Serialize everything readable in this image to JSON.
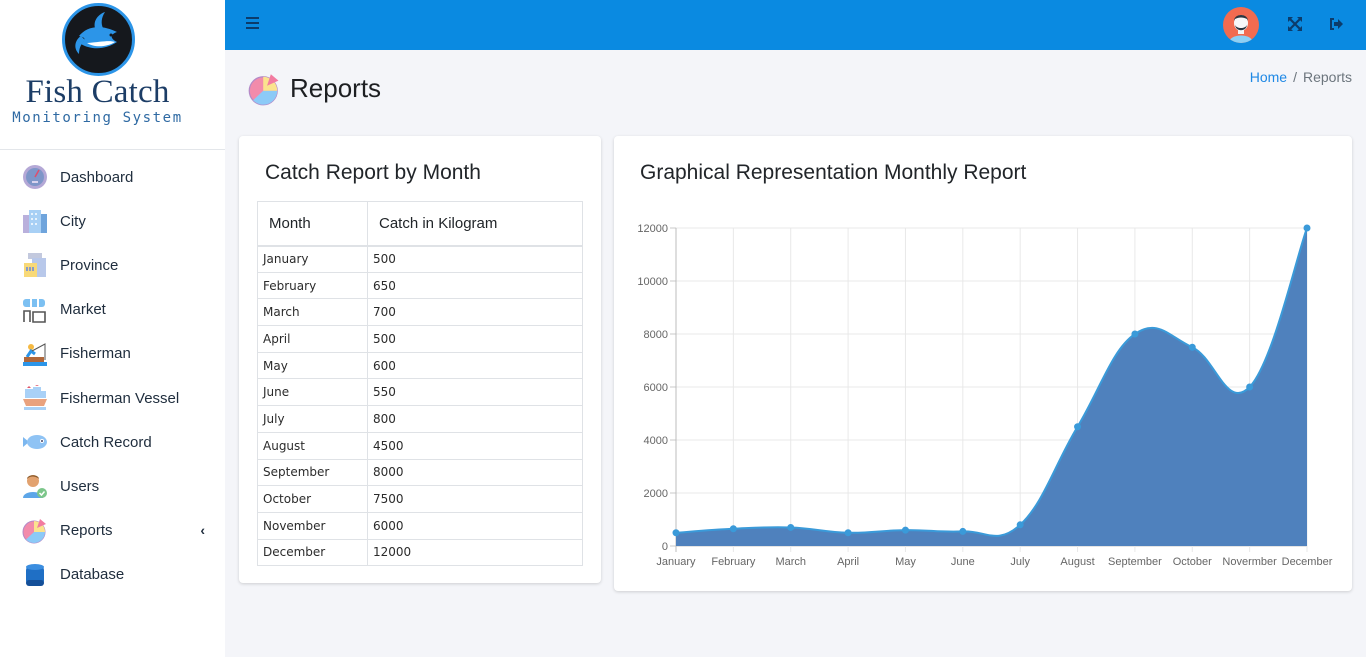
{
  "brand": {
    "title": "Fish Catch",
    "subtitle": "Monitoring System"
  },
  "sidebar": {
    "items": [
      {
        "label": "Dashboard",
        "icon": "dashboard-gauge-icon"
      },
      {
        "label": "City",
        "icon": "city-buildings-icon"
      },
      {
        "label": "Province",
        "icon": "province-building-icon"
      },
      {
        "label": "Market",
        "icon": "market-store-icon"
      },
      {
        "label": "Fisherman",
        "icon": "fisherman-icon"
      },
      {
        "label": "Fisherman Vessel",
        "icon": "vessel-ship-icon"
      },
      {
        "label": "Catch Record",
        "icon": "fish-icon"
      },
      {
        "label": "Users",
        "icon": "user-check-icon"
      },
      {
        "label": "Reports",
        "icon": "pie-chart-icon",
        "chevron": "‹"
      },
      {
        "label": "Database",
        "icon": "database-icon"
      }
    ]
  },
  "topbar": {
    "menu_icon": "hamburger-icon",
    "avatar_icon": "user-avatar",
    "fullscreen_icon": "expand-icon",
    "logout_icon": "sign-out-icon",
    "color": "#0a8ae1"
  },
  "page": {
    "title": "Reports",
    "breadcrumb": {
      "home": "Home",
      "separator": "/",
      "current": "Reports"
    }
  },
  "table_card": {
    "title": "Catch Report by Month",
    "headers": [
      "Month",
      "Catch in Kilogram"
    ],
    "rows": [
      [
        "January",
        "500"
      ],
      [
        "February",
        "650"
      ],
      [
        "March",
        "700"
      ],
      [
        "April",
        "500"
      ],
      [
        "May",
        "600"
      ],
      [
        "June",
        "550"
      ],
      [
        "July",
        "800"
      ],
      [
        "August",
        "4500"
      ],
      [
        "September",
        "8000"
      ],
      [
        "October",
        "7500"
      ],
      [
        "November",
        "6000"
      ],
      [
        "December",
        "12000"
      ]
    ]
  },
  "chart_card": {
    "title": "Graphical Representation Monthly Report"
  },
  "chart_data": {
    "type": "area",
    "title": "Graphical Representation Monthly Report",
    "xlabel": "",
    "ylabel": "",
    "categories": [
      "January",
      "February",
      "March",
      "April",
      "May",
      "June",
      "July",
      "August",
      "September",
      "October",
      "Novermber",
      "December"
    ],
    "series": [
      {
        "name": "Catch in Kilogram",
        "values": [
          500,
          650,
          700,
          500,
          600,
          550,
          800,
          4500,
          8000,
          7500,
          6000,
          12000
        ],
        "fill": "#4f81bd",
        "line": "#3a9ad9"
      }
    ],
    "ylim": [
      0,
      12000
    ],
    "yticks": [
      0,
      2000,
      4000,
      6000,
      8000,
      10000,
      12000
    ],
    "grid": true,
    "legend": "none",
    "smooth": true
  }
}
